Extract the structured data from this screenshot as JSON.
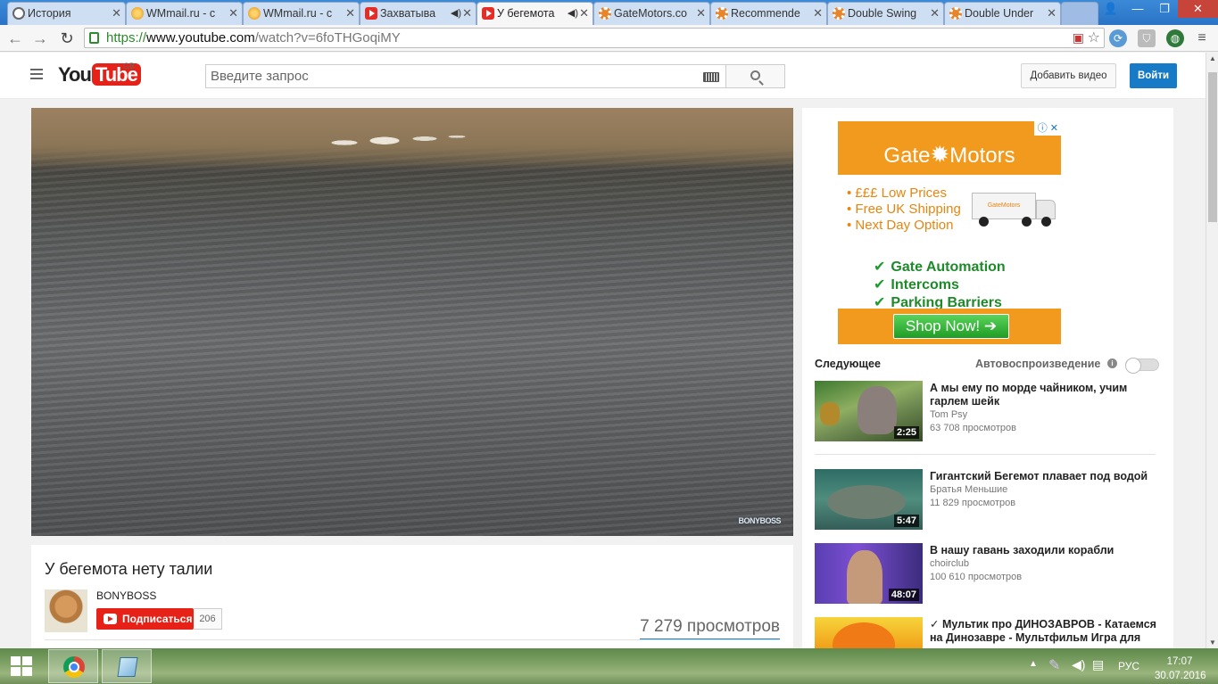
{
  "browser": {
    "tabs": [
      {
        "title": "История",
        "icon": "history-icon"
      },
      {
        "title": "WMmail.ru - с",
        "icon": "wmmail-icon"
      },
      {
        "title": "WMmail.ru - с",
        "icon": "wmmail-icon"
      },
      {
        "title": "Захватыва",
        "icon": "youtube-icon"
      },
      {
        "title": "У бегемота",
        "icon": "youtube-icon"
      },
      {
        "title": "GateMotors.co",
        "icon": "gear-icon"
      },
      {
        "title": "Recommende",
        "icon": "gear-icon"
      },
      {
        "title": "Double Swing",
        "icon": "gear-icon"
      },
      {
        "title": "Double Under",
        "icon": "gear-icon"
      }
    ],
    "url_protocol": "https://",
    "url_domain": "www.youtube.com",
    "url_path": "/watch?v=6foTHGoqiMY"
  },
  "youtube": {
    "logo_you": "You",
    "logo_tube": "Tube",
    "region": "GB",
    "search_placeholder": "Введите запрос",
    "upload_label": "Добавить видео",
    "login_label": "Войти"
  },
  "player": {
    "watermark": "BONYBOSS"
  },
  "video": {
    "title": "У бегемота нету талии",
    "channel": "BONYBOSS",
    "subscribe_label": "Подписаться",
    "subscriber_count": "206",
    "views": "7 279 просмотров"
  },
  "ad": {
    "brand_left": "Gate",
    "brand_right": "Motors",
    "bullets": [
      "• £££ Low Prices",
      "• Free UK Shipping",
      "• Next Day Option"
    ],
    "truck_label": "GateMotors",
    "checks": [
      "Gate Automation",
      "Intercoms",
      "Parking Barriers"
    ],
    "cta": "Shop Now!"
  },
  "sidebar": {
    "up_next": "Следующее",
    "autoplay": "Автовоспроизведение",
    "recommendations": [
      {
        "title": "А мы ему по морде чайником, учим гарлем шейк",
        "channel": "Tom Psy",
        "views": "63 708 просмотров",
        "duration": "2:25"
      },
      {
        "title": "Гигантский Бегемот плавает под водой",
        "channel": "Братья Меньшие",
        "views": "11 829 просмотров",
        "duration": "5:47"
      },
      {
        "title": "В нашу гавань заходили корабли",
        "channel": "choirclub",
        "views": "100 610 просмотров",
        "duration": "48:07"
      },
      {
        "title": "✓ Мультик про ДИНОЗАВРОВ - Катаемся на Динозавре - Мультфильм Игра для",
        "channel": "",
        "views": "",
        "duration": ""
      }
    ]
  },
  "taskbar": {
    "language": "РУС",
    "time": "17:07",
    "date": "30.07.2016"
  }
}
